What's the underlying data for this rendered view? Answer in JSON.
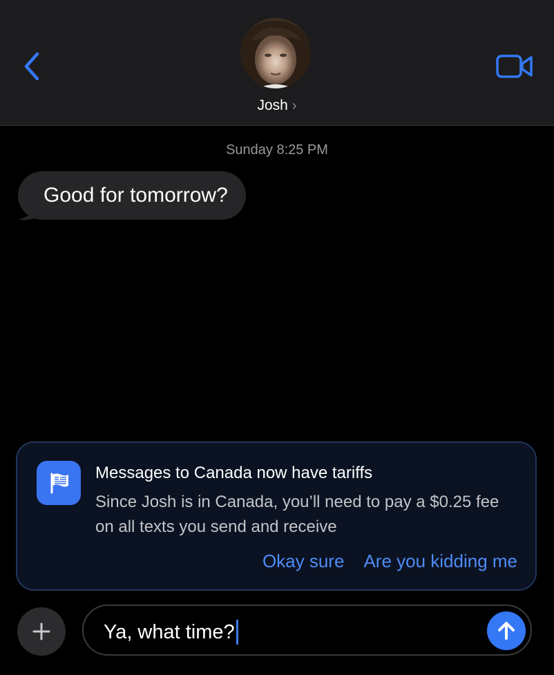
{
  "header": {
    "contact_name": "Josh",
    "chevron": "›",
    "back_icon": "chevron-left-icon",
    "video_icon": "video-camera-icon",
    "accent_color": "#3478f6"
  },
  "conversation": {
    "timestamp": "Sunday 8:25 PM",
    "messages": [
      {
        "from": "Josh",
        "text": "Good for tomorrow?"
      }
    ]
  },
  "tariff_card": {
    "icon": "flag-icon",
    "title": "Messages to Canada now have tariffs",
    "body": "Since Josh is in Canada, you’ll need to pay a $0.25 fee on all texts you send and receive",
    "actions": [
      {
        "label": "Okay sure"
      },
      {
        "label": "Are you kidding me"
      }
    ]
  },
  "composer": {
    "add_icon": "plus-icon",
    "value": "Ya, what time?",
    "send_icon": "arrow-up-icon"
  }
}
